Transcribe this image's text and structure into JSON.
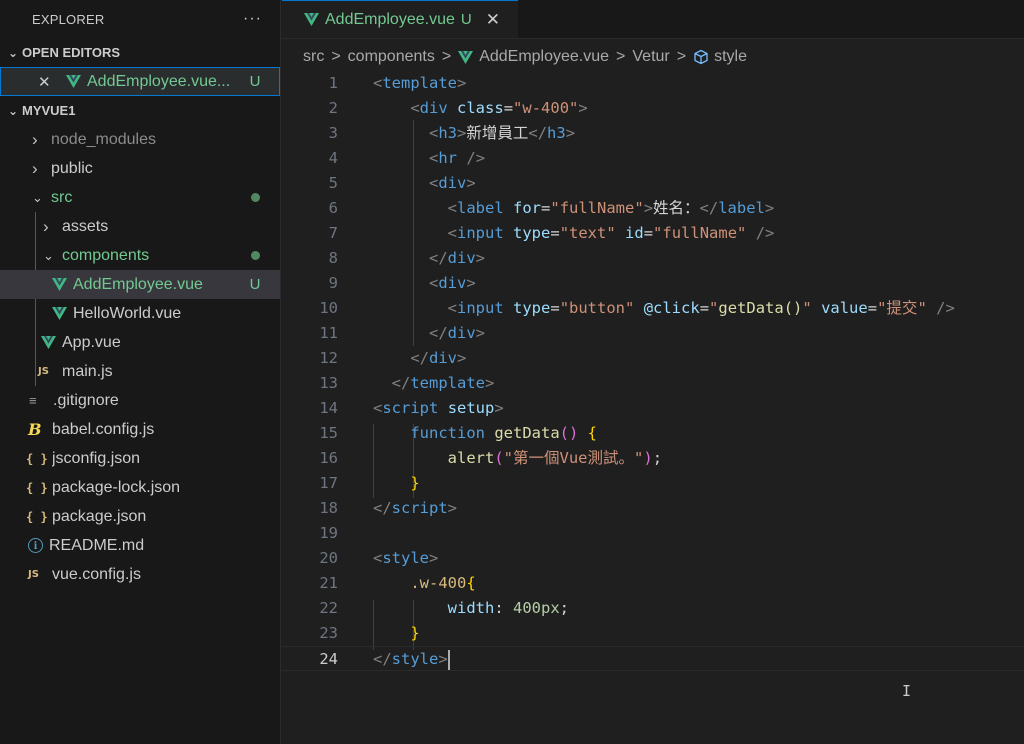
{
  "explorer": {
    "title": "EXPLORER",
    "more": "···",
    "open_editors_label": "OPEN EDITORS",
    "open_editor_file": "AddEmployee.vue...",
    "open_editor_badge": "U",
    "project_label": "MYVUE1"
  },
  "tree": {
    "node_modules": "node_modules",
    "public": "public",
    "src": "src",
    "assets": "assets",
    "components": "components",
    "add_employee": "AddEmployee.vue",
    "add_employee_badge": "U",
    "hello_world": "HelloWorld.vue",
    "app_vue": "App.vue",
    "main_js": "main.js",
    "gitignore": ".gitignore",
    "babel_config": "babel.config.js",
    "jsconfig": "jsconfig.json",
    "package_lock": "package-lock.json",
    "package_json": "package.json",
    "readme": "README.md",
    "vue_config": "vue.config.js"
  },
  "icons": {
    "js": "JS",
    "json": "{ }",
    "babel": "B",
    "gitignore": "≡",
    "info": "i",
    "chevron_right": "›",
    "chevron_down": "⌄",
    "close": "✕"
  },
  "tab": {
    "label": "AddEmployee.vue",
    "badge": "U",
    "close": "✕"
  },
  "breadcrumb": {
    "items": [
      "src",
      "components",
      "AddEmployee.vue",
      "Vetur",
      "style"
    ],
    "sep": ">"
  },
  "editor": {
    "line_numbers": [
      "1",
      "2",
      "3",
      "4",
      "5",
      "6",
      "7",
      "8",
      "9",
      "10",
      "11",
      "12",
      "13",
      "14",
      "15",
      "16",
      "17",
      "18",
      "19",
      "20",
      "21",
      "22",
      "23",
      "24"
    ],
    "current_line": "24",
    "code": {
      "h3_text": "新增員工",
      "label_text": "姓名：",
      "button_value": "提交",
      "alert_text": "\"第一個Vue測試。\"",
      "div_class": "\"w-400\"",
      "label_for": "\"fullName\"",
      "input_type_text": "\"text\"",
      "input_id": "\"fullName\"",
      "input_type_button": "\"button\"",
      "click_handler": "getData()",
      "function_name": "getData",
      "css_selector": ".w-400",
      "css_prop": "width",
      "css_value": "400px"
    }
  },
  "colors": {
    "accent": "#0078d4",
    "untracked": "#73c991",
    "vue_green": "#41b883",
    "vue_dark": "#35495e",
    "modified_dot": "#52885f"
  }
}
